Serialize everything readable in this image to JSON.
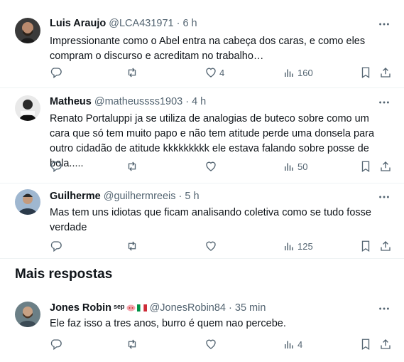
{
  "tweets": [
    {
      "name": "Luis Araujo",
      "handle": "@LCA431971",
      "time": "6 h",
      "text": "Impressionante como o Abel entra na cabeça dos caras, e como eles compram o discurso e acreditam no trabalho…",
      "likes": "4",
      "views": "160"
    },
    {
      "name": "Matheus",
      "handle": "@matheussss1903",
      "time": "4 h",
      "text": "Renato Portaluppi ja se utiliza de analogias de buteco sobre como um cara que só tem muito papo e não tem atitude perde uma donsela para outro cidadão de atitude kkkkkkkkk ele estava falando sobre posse de bola.....",
      "views": "50"
    },
    {
      "name": "Guilherme",
      "handle": "@guilhermreeis",
      "time": "5 h",
      "text": "Mas tem uns idiotas que ficam analisando coletiva como se tudo fosse verdade",
      "views": "125"
    }
  ],
  "section_title": "Mais respostas",
  "more_tweet": {
    "name": "Jones Robin",
    "tag": "sep",
    "handle": "@JonesRobin84",
    "time": "35 min",
    "text": "Ele faz isso a tres anos, burro é quem nao percebe.",
    "views": "4"
  },
  "separator": " · ",
  "icons": {
    "reply": "reply-icon",
    "retweet": "retweet-icon",
    "like": "heart-icon",
    "views": "views-icon",
    "bookmark": "bookmark-icon",
    "share": "share-icon",
    "more": "more-icon"
  },
  "colors": {
    "text": "#0f1419",
    "secondary": "#536471",
    "border": "#eff3f4"
  }
}
